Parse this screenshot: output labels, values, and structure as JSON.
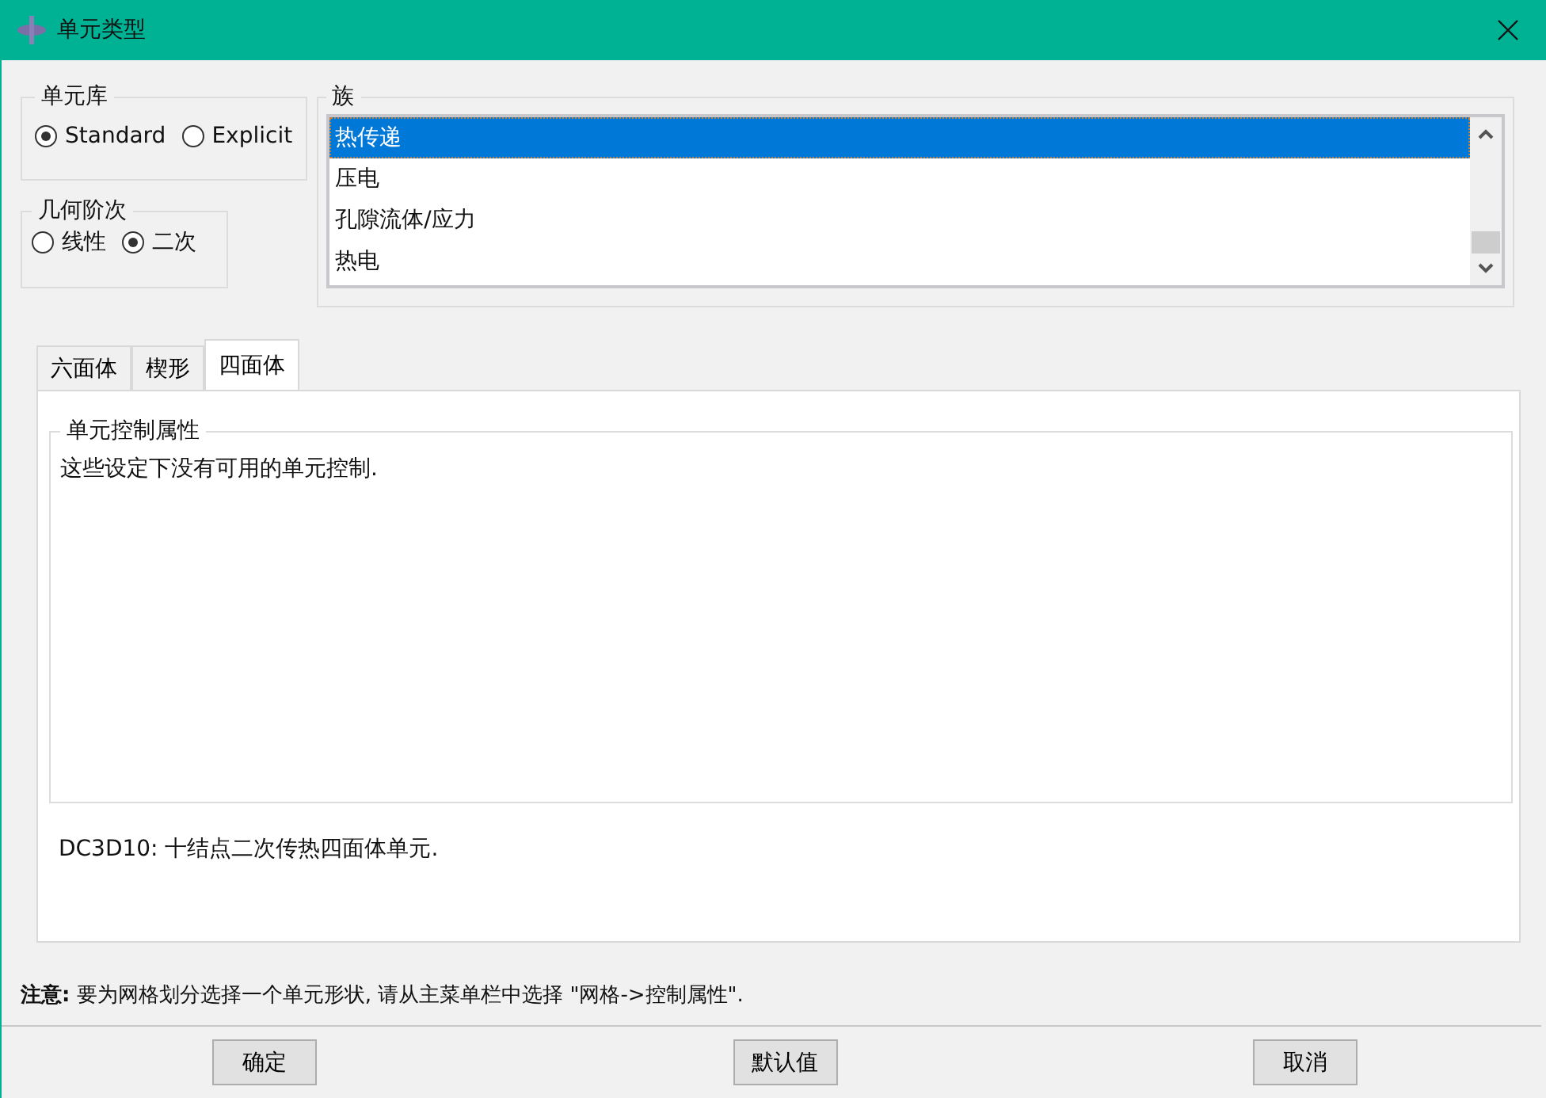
{
  "window": {
    "title": "单元类型"
  },
  "element_library": {
    "title": "单元库",
    "options": [
      {
        "label": "Standard",
        "selected": true
      },
      {
        "label": "Explicit",
        "selected": false
      }
    ]
  },
  "geometric_order": {
    "title": "几何阶次",
    "options": [
      {
        "label": "线性",
        "selected": false
      },
      {
        "label": "二次",
        "selected": true
      }
    ]
  },
  "family": {
    "title": "族",
    "items": [
      {
        "label": "热传递",
        "selected": true
      },
      {
        "label": "压电",
        "selected": false
      },
      {
        "label": "孔隙流体/应力",
        "selected": false
      },
      {
        "label": "热电",
        "selected": false
      }
    ]
  },
  "tabs": [
    {
      "label": "六面体",
      "selected": false
    },
    {
      "label": "楔形",
      "selected": false
    },
    {
      "label": "四面体",
      "selected": true
    }
  ],
  "element_controls": {
    "title": "单元控制属性",
    "message": "这些设定下没有可用的单元控制."
  },
  "description": "DC3D10:  十结点二次传热四面体单元.",
  "note": "**注意:**  要为网格划分选择一个单元形状, 请从主菜单栏中选择 \"网格->控制属性\".",
  "buttons": [
    "确定",
    "默认值",
    "取消"
  ]
}
